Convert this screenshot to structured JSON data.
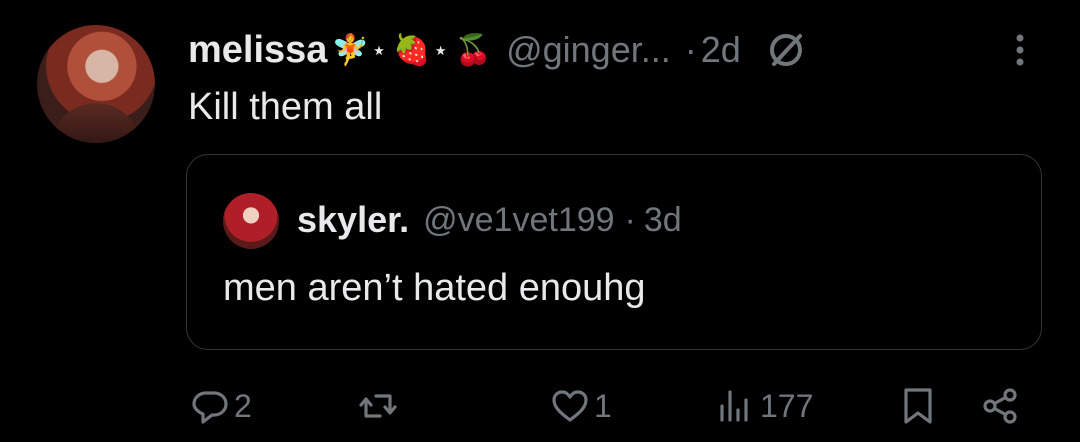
{
  "tweet": {
    "author_name": "melissa",
    "author_emojis": "🧚",
    "star1": "⋆",
    "strawberry": "🍓",
    "star2": "⋆",
    "cherry": "🍒",
    "handle": "@ginger...",
    "dot": "·",
    "age": "2d",
    "text": "Kill them all"
  },
  "quote": {
    "author_name": "skyler.",
    "handle": "@ve1vet199",
    "dot": "·",
    "age": "3d",
    "text": "men aren’t hated enouhg"
  },
  "actions": {
    "replies": "2",
    "reposts": "",
    "likes": "1",
    "views": "177"
  },
  "icons": {
    "reply": "reply-icon",
    "repost": "repost-icon",
    "like": "heart-icon",
    "views": "views-icon",
    "bookmark": "bookmark-icon",
    "share": "share-icon"
  },
  "colors": {
    "background": "#000000",
    "text": "#e7e9ea",
    "muted": "#71767b",
    "border": "#333639"
  }
}
